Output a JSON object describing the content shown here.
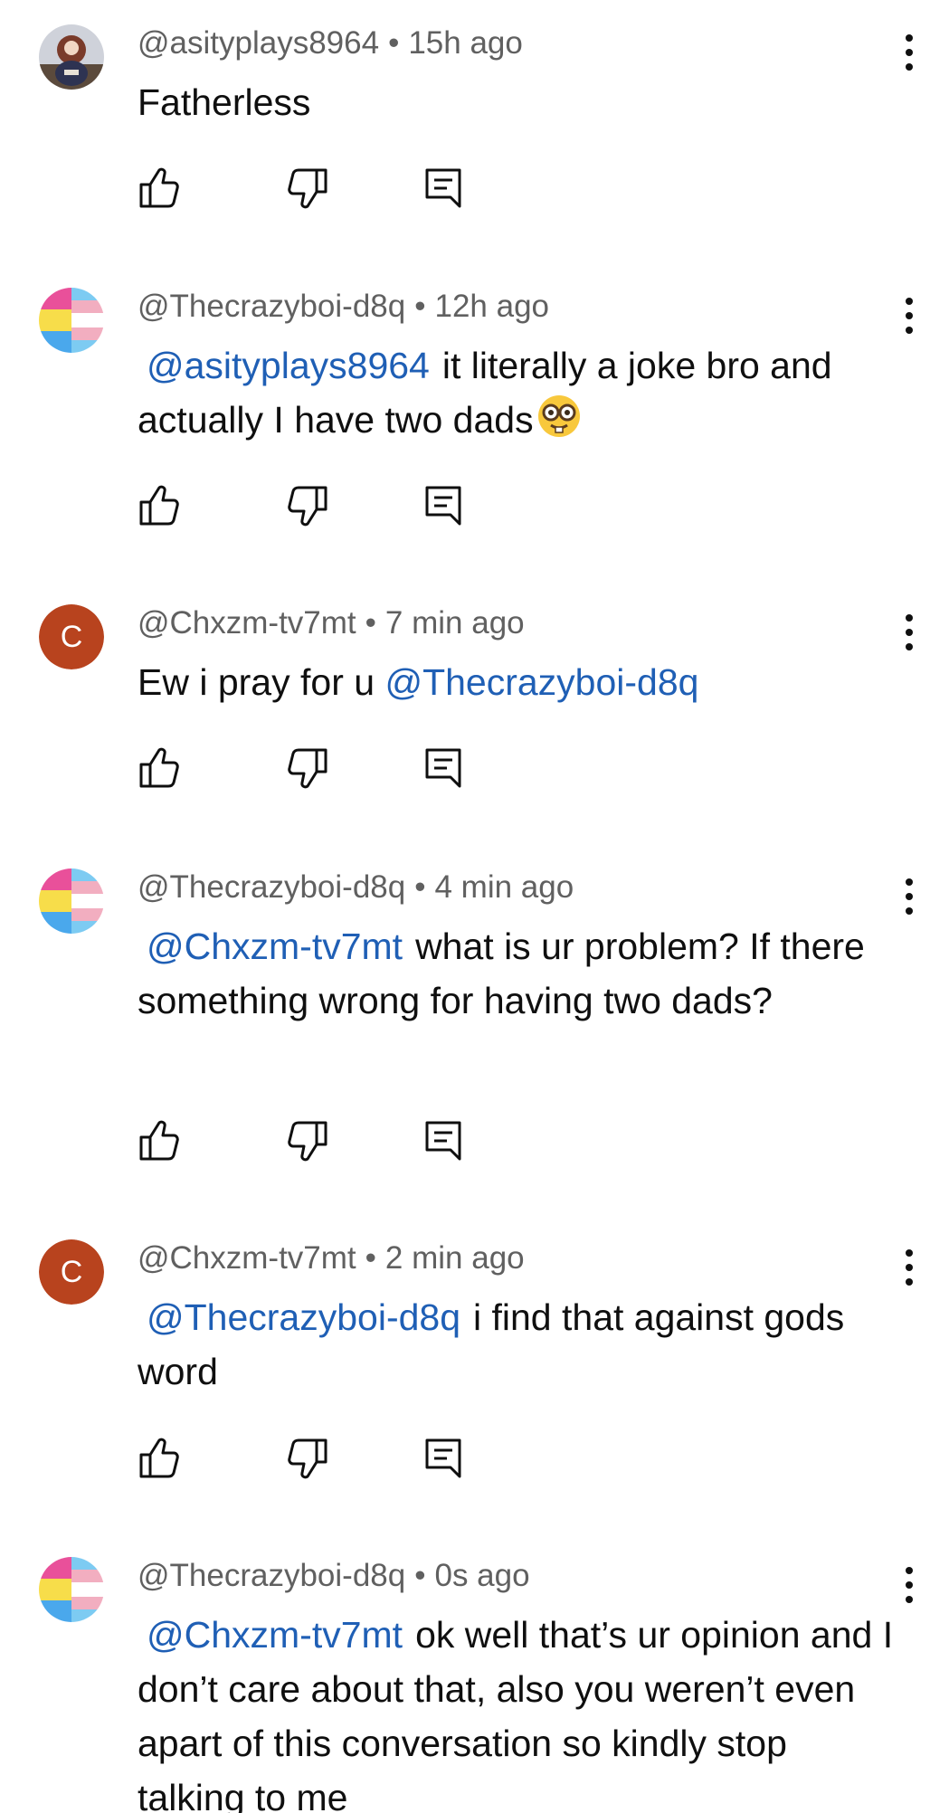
{
  "comments": [
    {
      "handle": "@asityplays8964",
      "time": "15h ago",
      "mention": "",
      "text": "Fatherless",
      "avatar_type": "photo"
    },
    {
      "handle": "@Thecrazyboi-d8q",
      "time": "12h ago",
      "mention": "@asityplays8964",
      "text": "it literally a joke bro and actually I have two dads",
      "emoji": "nerd-face-emoji",
      "avatar_type": "flag"
    },
    {
      "handle": "@Chxzm-tv7mt",
      "time": "7 min ago",
      "mention": "",
      "text": "Ew i pray for u",
      "trailing_mention": "@Thecrazyboi-d8q",
      "avatar_type": "letter",
      "avatar_letter": "C"
    },
    {
      "handle": "@Thecrazyboi-d8q",
      "time": "4 min ago",
      "mention": "@Chxzm-tv7mt",
      "text": "what is ur problem? If there something wrong for having two dads?",
      "avatar_type": "flag"
    },
    {
      "handle": "@Chxzm-tv7mt",
      "time": "2 min ago",
      "mention": "@Thecrazyboi-d8q",
      "text": "i find that against gods word",
      "avatar_type": "letter",
      "avatar_letter": "C"
    },
    {
      "handle": "@Thecrazyboi-d8q",
      "time": "0s ago",
      "mention": "@Chxzm-tv7mt",
      "text": "ok well that’s ur opinion and I don’t care about that, also you weren’t even apart of this conversation so kindly stop talking to me",
      "avatar_type": "flag"
    }
  ],
  "separator": "•",
  "icons": {
    "like": "thumbs-up-icon",
    "dislike": "thumbs-down-icon",
    "reply": "reply-icon",
    "more": "more-vertical-icon"
  },
  "colors": {
    "text": "#0f0f0f",
    "meta": "#606060",
    "mention": "#1f5fb5",
    "letter_avatar": "#b8431e",
    "flag_pink": "#e9509a",
    "flag_yellow": "#f7dd4a",
    "flag_blue": "#4aa8ec",
    "flag_light_blue": "#7dcbf2",
    "flag_light_pink": "#f2aec0"
  }
}
